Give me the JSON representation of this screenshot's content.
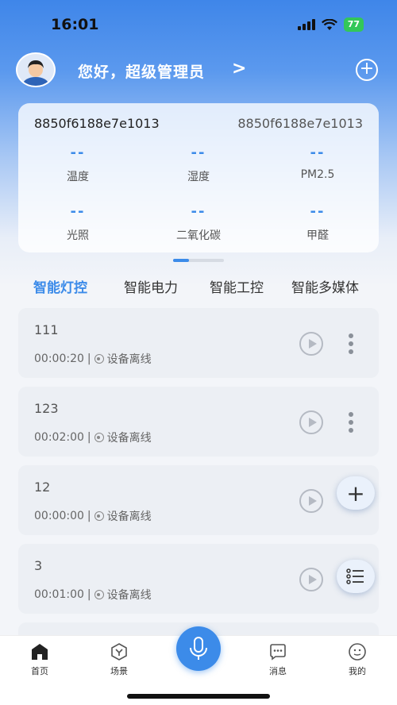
{
  "status": {
    "time": "16:01",
    "battery": "77"
  },
  "header": {
    "greeting": "您好，超级管理员",
    "chevron": ">",
    "add": "+"
  },
  "sensor_card": {
    "device_id_left": "8850f6188e7e1013",
    "device_id_right": "8850f6188e7e1013",
    "metrics": [
      {
        "value": "--",
        "label": "温度"
      },
      {
        "value": "--",
        "label": "湿度"
      },
      {
        "value": "--",
        "label": "PM2.5"
      },
      {
        "value": "--",
        "label": "光照"
      },
      {
        "value": "--",
        "label": "二氧化碳"
      },
      {
        "value": "--",
        "label": "甲醛"
      }
    ]
  },
  "tabs": [
    {
      "label": "智能灯控",
      "active": true
    },
    {
      "label": "智能电力",
      "active": false
    },
    {
      "label": "智能工控",
      "active": false
    },
    {
      "label": "智能多媒体",
      "active": false
    }
  ],
  "scenes": [
    {
      "name": "111",
      "duration": "00:00:20",
      "sep": "|",
      "status": "设备离线"
    },
    {
      "name": "123",
      "duration": "00:02:00",
      "sep": "|",
      "status": "设备离线"
    },
    {
      "name": "12",
      "duration": "00:00:00",
      "sep": "|",
      "status": "设备离线"
    },
    {
      "name": "3",
      "duration": "00:01:00",
      "sep": "|",
      "status": "设备离线"
    }
  ],
  "fab": {
    "add": "+"
  },
  "nav": {
    "home": "首页",
    "scene": "场景",
    "messages": "消息",
    "mine": "我的"
  },
  "colors": {
    "accent": "#3c8be9",
    "battery": "#33c759"
  },
  "icons": [
    "avatar",
    "add-circle-icon",
    "play-icon",
    "more-icon",
    "eye-icon",
    "list-icon",
    "home-icon",
    "scene-icon",
    "mic-icon",
    "message-icon",
    "profile-icon"
  ]
}
